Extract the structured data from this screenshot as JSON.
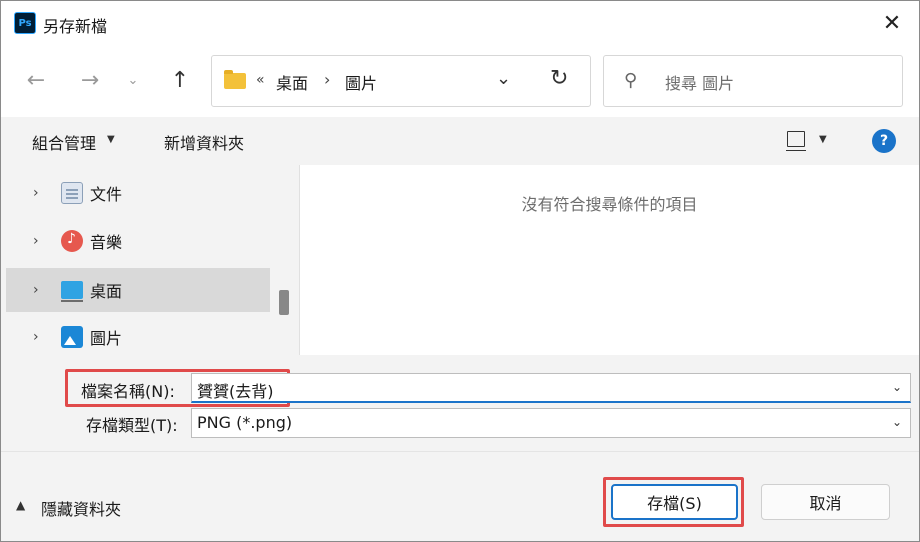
{
  "window": {
    "title": "另存新檔",
    "app_icon_text": "Ps",
    "close_glyph": "✕"
  },
  "nav": {
    "back_glyph": "←",
    "forward_glyph": "→",
    "recent_glyph": "⌄",
    "up_glyph": "↑",
    "address": {
      "overflow_glyph": "«",
      "crumbs": [
        "桌面",
        "圖片"
      ],
      "separator": "›",
      "dropdown_glyph": "⌄",
      "refresh_glyph": "↻"
    },
    "search": {
      "placeholder": "搜尋 圖片",
      "icon_glyph": "⚲"
    }
  },
  "toolbar": {
    "organize_label": "組合管理",
    "organize_caret": "▼",
    "new_folder_label": "新增資料夾",
    "view_caret": "▼",
    "help_glyph": "?"
  },
  "sidebar": {
    "caret_glyph": "›",
    "items": [
      {
        "label": "文件",
        "icon": "documents-icon"
      },
      {
        "label": "音樂",
        "icon": "music-icon"
      },
      {
        "label": "桌面",
        "icon": "desktop-icon",
        "selected": true
      },
      {
        "label": "圖片",
        "icon": "pictures-icon"
      }
    ]
  },
  "file_pane": {
    "empty_message": "沒有符合搜尋條件的項目"
  },
  "form": {
    "filename_label": "檔案名稱(N):",
    "filename_value": "贇贇(去背)",
    "filetype_label": "存檔類型(T):",
    "filetype_value": "PNG (*.png)",
    "dropdown_glyph": "⌄"
  },
  "footer": {
    "hide_folders_caret": "▲",
    "hide_folders_label": "隱藏資料夾",
    "save_label": "存檔(S)",
    "cancel_label": "取消"
  },
  "colors": {
    "accent": "#1a73c9",
    "highlight_box": "#e04a4a",
    "selected_row": "#d9d9d9"
  }
}
